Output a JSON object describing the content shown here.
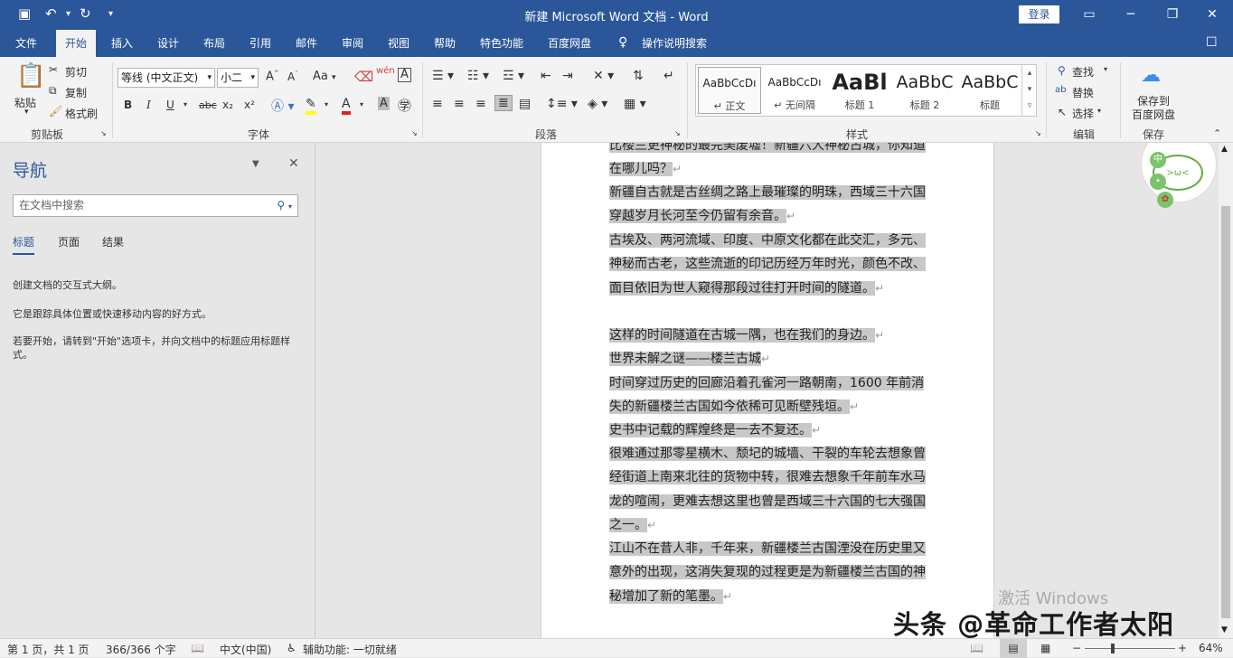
{
  "titlebar": {
    "title": "新建 Microsoft Word 文档  -  Word",
    "login": "登录"
  },
  "menubar": {
    "tabs": [
      "文件",
      "开始",
      "插入",
      "设计",
      "布局",
      "引用",
      "邮件",
      "审阅",
      "视图",
      "帮助",
      "特色功能",
      "百度网盘"
    ],
    "search_hint": "操作说明搜索",
    "active": "开始"
  },
  "ribbon": {
    "clipboard": {
      "paste": "粘贴",
      "cut": "剪切",
      "copy": "复制",
      "format_painter": "格式刷",
      "label": "剪贴板"
    },
    "font": {
      "font_name": "等线 (中文正文)",
      "font_size": "小二",
      "label": "字体",
      "aa": "Aa",
      "wen": "wén",
      "b": "B",
      "i": "I",
      "u": "U",
      "strike": "abc",
      "sub": "x₂",
      "sup": "x²"
    },
    "paragraph": {
      "label": "段落"
    },
    "styles": {
      "label": "样式",
      "items": [
        {
          "preview": "AaBbCcDı",
          "name": "↵ 正文"
        },
        {
          "preview": "AaBbCcDı",
          "name": "↵ 无间隔"
        },
        {
          "preview": "AaBl",
          "name": "标题 1"
        },
        {
          "preview": "AaBbC",
          "name": "标题 2"
        },
        {
          "preview": "AaBbC",
          "name": "标题"
        }
      ]
    },
    "editing": {
      "find": "查找",
      "replace": "替换",
      "select": "选择",
      "label": "编辑"
    },
    "save": {
      "line1": "保存到",
      "line2": "百度网盘",
      "label": "保存"
    }
  },
  "nav": {
    "title": "导航",
    "search_placeholder": "在文档中搜索",
    "tabs": [
      "标题",
      "页面",
      "结果"
    ],
    "p1": "创建文档的交互式大纲。",
    "p2": "它是跟踪具体位置或快速移动内容的好方式。",
    "p3": "若要开始，请转到\"开始\"选项卡，并向文档中的标题应用标题样式。"
  },
  "doc": {
    "paragraphs": [
      "比楼兰更神秘的最完美废墟！新疆六大神秘古城，你知道在哪儿吗？",
      "新疆自古就是古丝绸之路上最璀璨的明珠，西域三十六国穿越岁月长河至今仍留有余音。",
      "古埃及、两河流域、印度、中原文化都在此交汇，多元、神秘而古老，这些流逝的印记历经万年时光，颜色不改、面目依旧为世人窥得那段过往打开时间的隧道。",
      "这样的时间隧道在古城一隅，也在我们的身边。",
      "世界未解之谜——楼兰古城",
      "时间穿过历史的回廊沿着孔雀河一路朝南，1600 年前消失的新疆楼兰古国如今依稀可见断壁残垣。",
      "史书中记载的辉煌终是一去不复还。",
      "很难通过那零星横木、颓圮的城墙、干裂的车轮去想象曾经街道上南来北往的货物中转，很难去想象千年前车水马龙的喧闹，更难去想这里也曾是西域三十六国的七大强国之一。",
      "江山不在昔人非，千年来，新疆楼兰古国湮没在历史里又意外的出现，这消失复现的过程更是为新疆楼兰古国的神秘增加了新的笔墨。"
    ]
  },
  "status": {
    "page": "第 1 页，共 1 页",
    "words": "366/366 个字",
    "lang": "中文(中国)",
    "accessibility": "辅助功能: 一切就绪",
    "zoom": "64%"
  },
  "overlay": {
    "activate": "激活 Windows",
    "watermark": "头条 @革命工作者太阳"
  }
}
